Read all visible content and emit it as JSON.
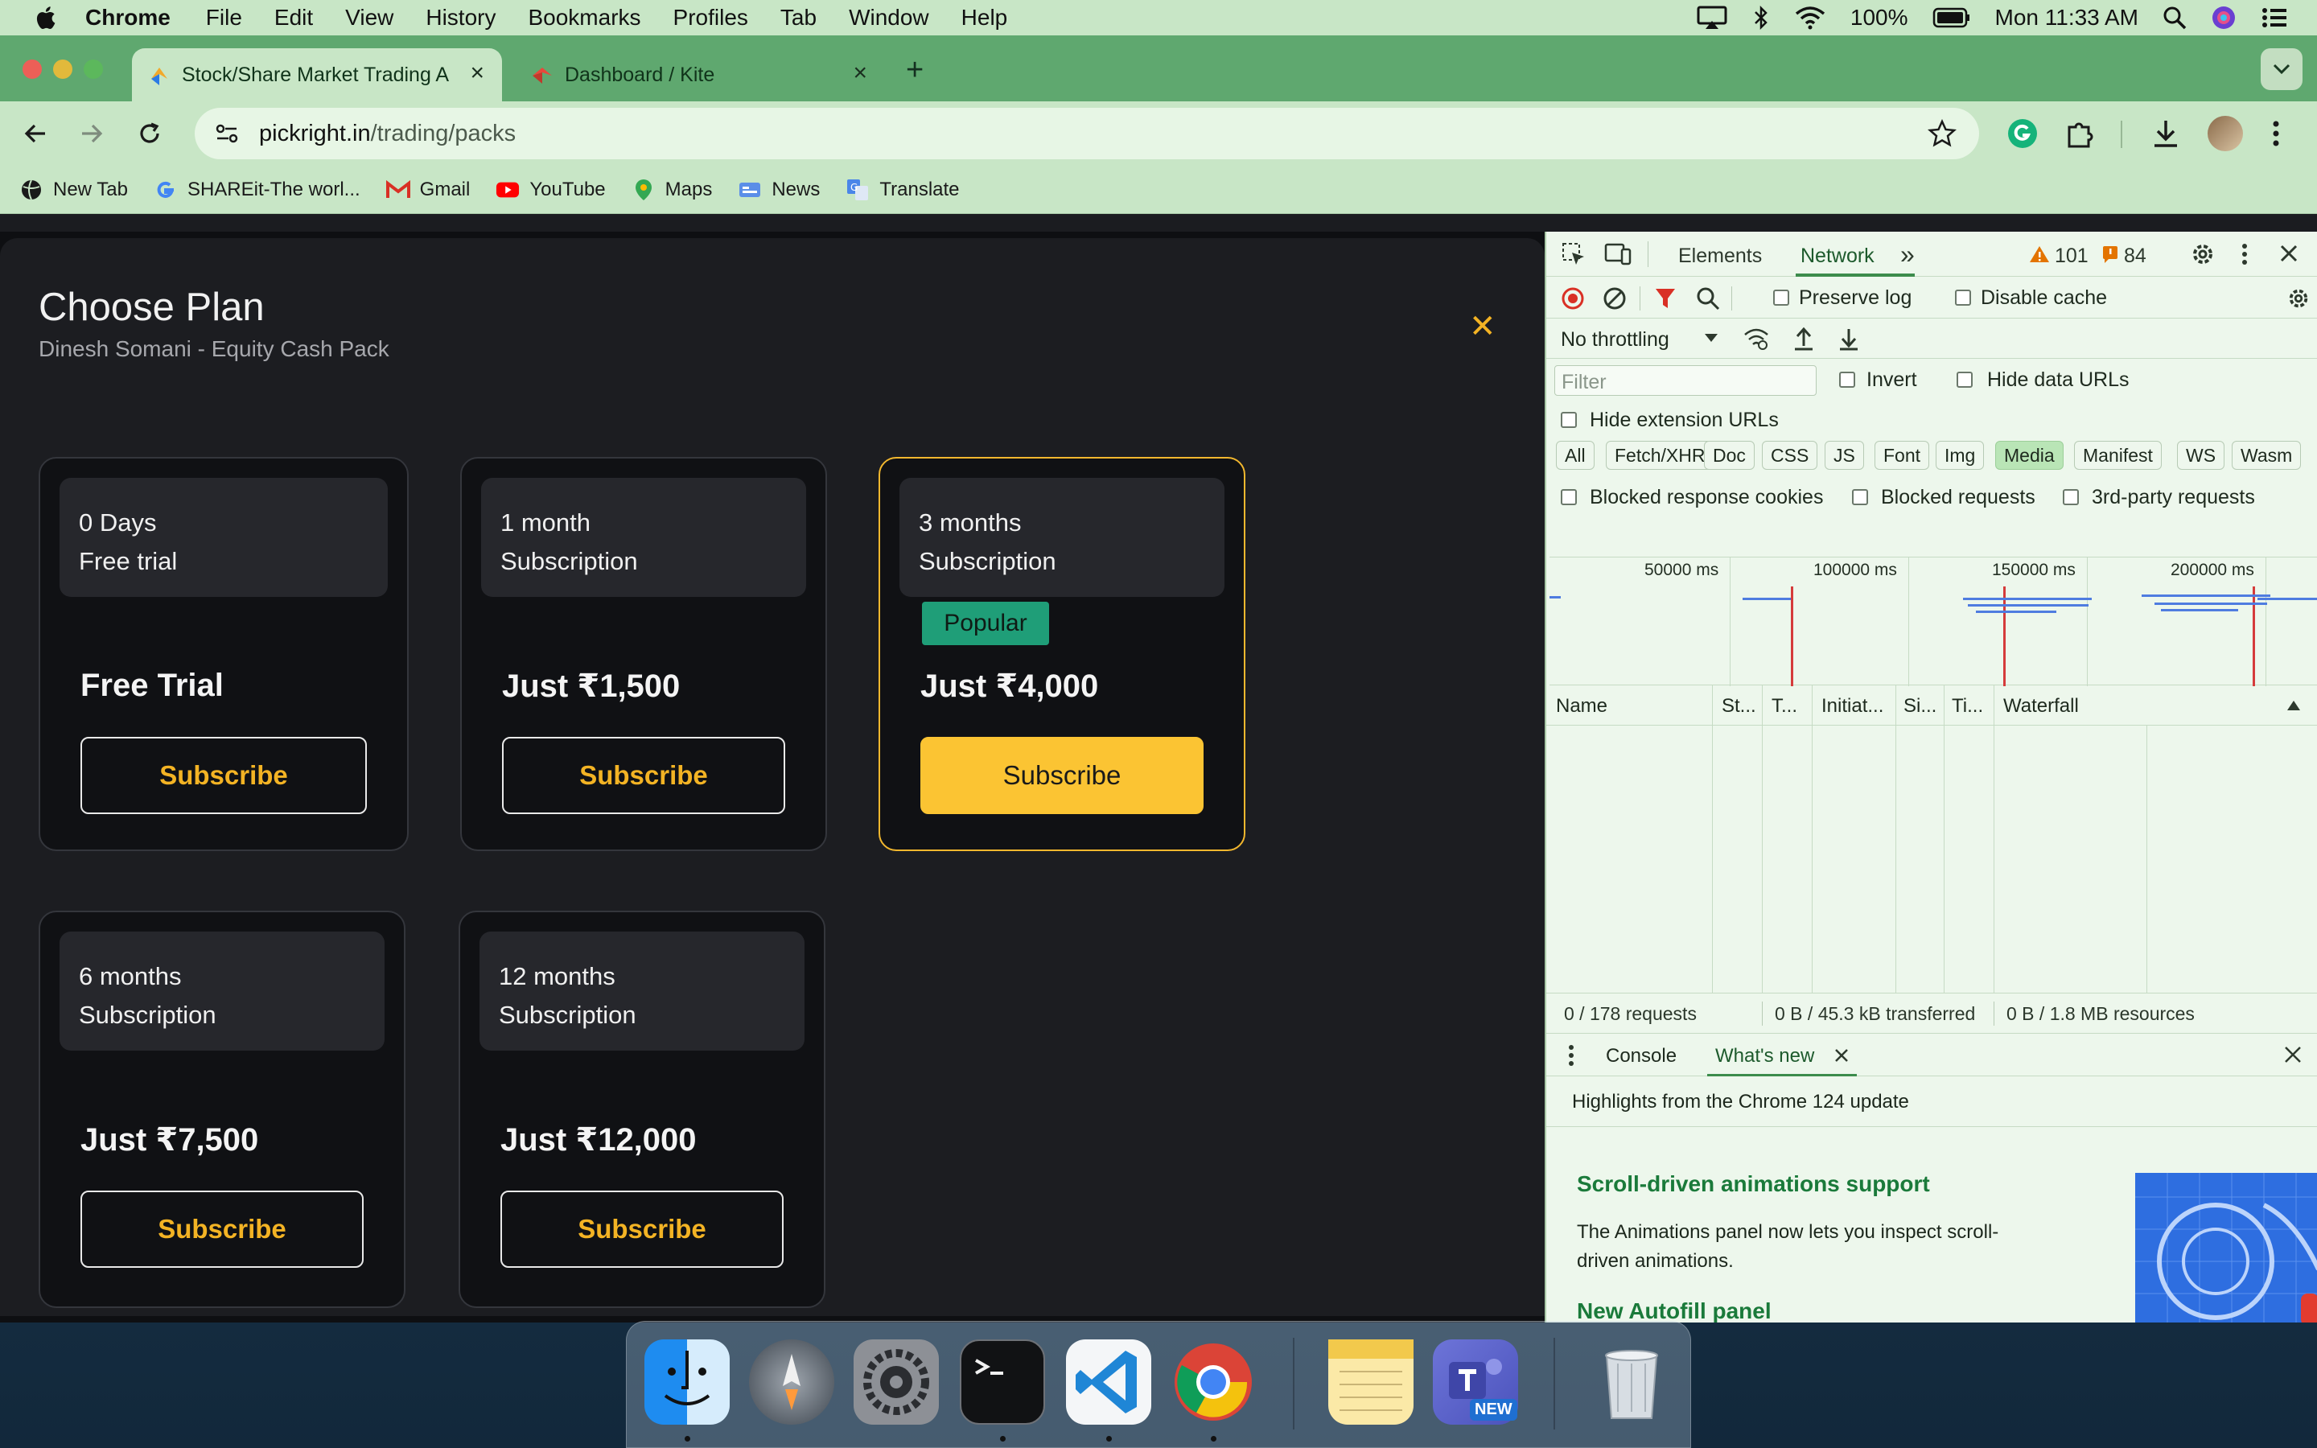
{
  "menubar": {
    "app_name": "Chrome",
    "items": [
      "File",
      "Edit",
      "View",
      "History",
      "Bookmarks",
      "Profiles",
      "Tab",
      "Window",
      "Help"
    ],
    "battery": "100%",
    "clock": "Mon 11:33 AM"
  },
  "tabs": [
    {
      "title": "Stock/Share Market Trading A",
      "active": true
    },
    {
      "title": "Dashboard / Kite",
      "active": false
    }
  ],
  "omnibox": {
    "host": "pickright.in",
    "path": "/trading/packs"
  },
  "bookmarks": [
    {
      "label": "New Tab",
      "icon": "globe-icon"
    },
    {
      "label": "SHAREit-The worl...",
      "icon": "google-icon"
    },
    {
      "label": "Gmail",
      "icon": "gmail-icon"
    },
    {
      "label": "YouTube",
      "icon": "youtube-icon"
    },
    {
      "label": "Maps",
      "icon": "maps-icon"
    },
    {
      "label": "News",
      "icon": "news-icon"
    },
    {
      "label": "Translate",
      "icon": "translate-icon"
    }
  ],
  "modal": {
    "title": "Choose Plan",
    "subtitle": "Dinesh Somani - Equity Cash Pack",
    "close_glyph": "✕"
  },
  "plans": [
    {
      "line1": "0 Days",
      "line2": "Free trial",
      "price": "Free Trial",
      "button": "Subscribe",
      "highlighted": false
    },
    {
      "line1": "1 month",
      "line2": "Subscription",
      "price": "Just ₹1,500",
      "button": "Subscribe",
      "highlighted": false
    },
    {
      "line1": "3 months",
      "line2": "Subscription",
      "price": "Just ₹4,000",
      "button": "Subscribe",
      "highlighted": true,
      "badge": "Popular"
    },
    {
      "line1": "6 months",
      "line2": "Subscription",
      "price": "Just ₹7,500",
      "button": "Subscribe",
      "highlighted": false
    },
    {
      "line1": "12 months",
      "line2": "Subscription",
      "price": "Just ₹12,000",
      "button": "Subscribe",
      "highlighted": false
    }
  ],
  "devtools": {
    "tabs": [
      "Elements",
      "Network"
    ],
    "more_tabs": "»",
    "warnings": "101",
    "issues": "84",
    "preserve_log": "Preserve log",
    "disable_cache": "Disable cache",
    "throttling": "No throttling",
    "filter_placeholder": "Filter",
    "invert": "Invert",
    "hide_data_urls": "Hide data URLs",
    "hide_extension_urls": "Hide extension URLs",
    "type_filters": [
      "All",
      "Fetch/XHR",
      "Doc",
      "CSS",
      "JS",
      "Font",
      "Img",
      "Media",
      "Manifest",
      "WS",
      "Wasm"
    ],
    "active_filter": "Media",
    "blocked_cookies": "Blocked response cookies",
    "blocked_requests": "Blocked requests",
    "third_party": "3rd-party requests",
    "timeline_labels": [
      "50000 ms",
      "100000 ms",
      "150000 ms",
      "200000 ms"
    ],
    "columns": [
      "Name",
      "St...",
      "T...",
      "Initiat...",
      "Si...",
      "Ti...",
      "Waterfall"
    ],
    "status": {
      "requests": "0 / 178 requests",
      "transferred": "0 B / 45.3 kB transferred",
      "resources": "0 B / 1.8 MB resources"
    },
    "drawer_tabs": [
      "Console",
      "What's new"
    ],
    "whats_new": {
      "highlight": "Highlights from the Chrome 124 update",
      "h1": "Scroll-driven animations support",
      "p1": "The Animations panel now lets you inspect scroll-driven animations.",
      "h2": "New Autofill panel"
    }
  },
  "dock": {
    "apps": [
      "finder-icon",
      "launchpad-icon",
      "system-settings-icon",
      "terminal-icon",
      "vscode-icon",
      "chrome-icon",
      "notes-icon",
      "teams-icon",
      "trash-icon"
    ],
    "teams_badge": "NEW"
  },
  "colors": {
    "accent_yellow": "#fbc433",
    "popular_green": "#1f9e78",
    "chrome_frame": "#c8e6c6"
  }
}
